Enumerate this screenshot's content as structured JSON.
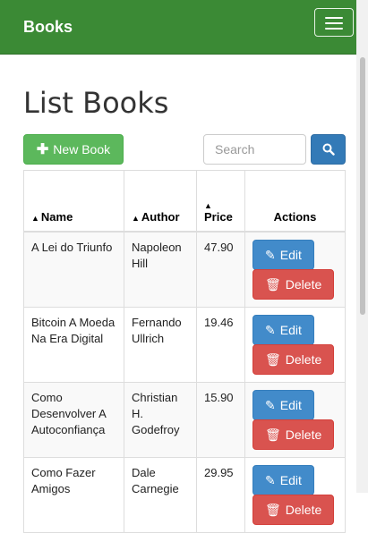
{
  "navbar": {
    "brand": "Books"
  },
  "page": {
    "title": "List Books"
  },
  "toolbar": {
    "new_label": "New Book",
    "search_placeholder": "Search"
  },
  "table": {
    "headers": {
      "name": "Name",
      "author": "Author",
      "price": "Price",
      "actions": "Actions"
    },
    "rows": [
      {
        "name": "A Lei do Triunfo",
        "author": "Napoleon Hill",
        "price": "47.90"
      },
      {
        "name": "Bitcoin A Moeda Na Era Digital",
        "author": "Fernando Ullrich",
        "price": "19.46"
      },
      {
        "name": "Como Desenvolver A Autoconfiança",
        "author": "Christian H. Godefroy",
        "price": "15.90"
      },
      {
        "name": "Como Fazer Amigos",
        "author": "Dale Carnegie",
        "price": "29.95"
      }
    ],
    "edit_label": "Edit",
    "delete_label": "Delete"
  },
  "colors": {
    "navbar": "#3b8a35",
    "success": "#5cb85c",
    "primary": "#428bca",
    "danger": "#d9534f"
  }
}
